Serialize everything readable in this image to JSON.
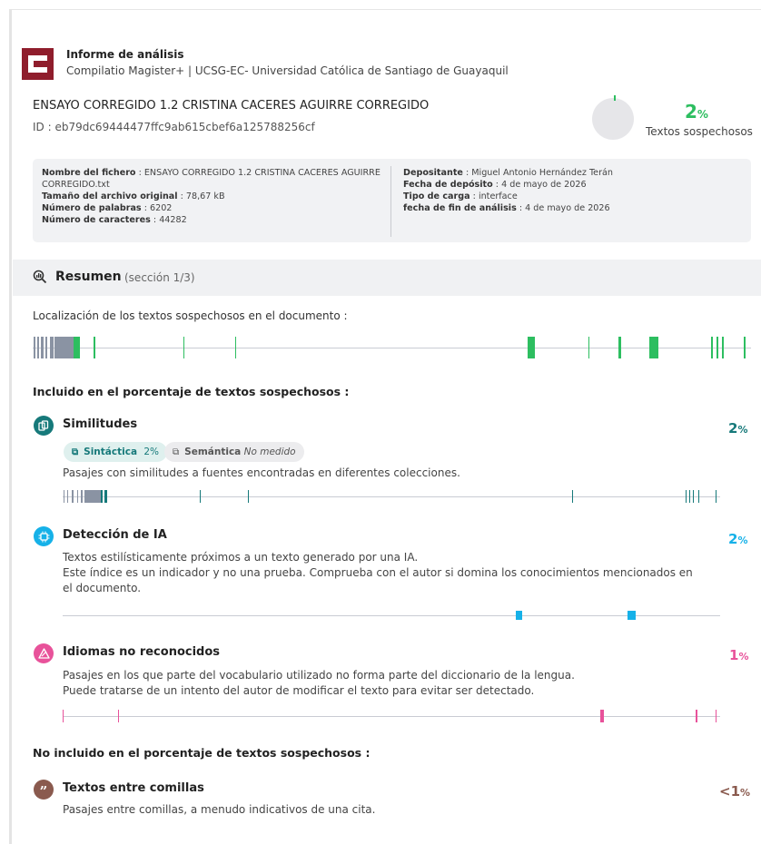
{
  "header": {
    "report_title": "Informe de análisis",
    "report_subtitle": "Compilatio Magister+ | UCSG-EC- Universidad Católica de Santiago de Guayaquil",
    "document_title": "ENSAYO CORREGIDO 1.2 CRISTINA CACERES AGUIRRE CORREGIDO",
    "document_id": "ID : eb79dc69444477ffc9ab615cbef6a125788256cf",
    "score_value": "2",
    "score_unit": "%",
    "score_label": "Textos sospechosos",
    "score_fraction": 0.02
  },
  "file_info": {
    "left": [
      {
        "label": "Nombre del fichero",
        "value": "ENSAYO CORREGIDO 1.2 CRISTINA CACERES AGUIRRE CORREGIDO.txt"
      },
      {
        "label": "Tamaño del archivo original",
        "value": "78,67 kB"
      },
      {
        "label": "Número de palabras",
        "value": "6202"
      },
      {
        "label": "Número de caracteres",
        "value": "44282"
      }
    ],
    "right": [
      {
        "label": "Depositante",
        "value": "Miguel Antonio Hernández Terán"
      },
      {
        "label": "Fecha de depósito",
        "value": "4 de mayo de 2026"
      },
      {
        "label": "Tipo de carga",
        "value": "interface"
      },
      {
        "label": "fecha de fin de análisis",
        "value": "4 de mayo de 2026"
      }
    ]
  },
  "summary": {
    "title": "Resumen",
    "section": "(sección 1/3)",
    "location_label": "Localización de los textos sospechosos en el documento :"
  },
  "included_heading": "Incluido en el porcentaje de textos sospechosos :",
  "not_included_heading": "No incluido en el porcentaje de textos sospechosos :",
  "categories": {
    "similitudes": {
      "title": "Similitudes",
      "pct_value": "2",
      "pct_unit": "%",
      "chip_sintactica_label": "Sintáctica",
      "chip_sintactica_value": "2%",
      "chip_semantica_label": "Semántica",
      "chip_semantica_value": "No medido",
      "description": "Pasajes con similitudes a fuentes encontradas en diferentes colecciones.",
      "color": "#16797a"
    },
    "ia": {
      "title": "Detección de IA",
      "pct_value": "2",
      "pct_unit": "%",
      "description_1": "Textos estilísticamente próximos a un texto generado por una IA.",
      "description_2": "Este índice es un indicador y no una prueba. Comprueba con el autor si domina los conocimientos mencionados en el documento.",
      "color": "#16b1e8"
    },
    "idiomas": {
      "title": "Idiomas no reconocidos",
      "pct_value": "1",
      "pct_unit": "%",
      "description_1": "Pasajes en los que parte del vocabulario utilizado no forma parte del diccionario de la lengua.",
      "description_2": "Puede tratarse de un intento del autor de modificar el texto para evitar ser detectado.",
      "color": "#e8529a"
    },
    "comillas": {
      "title": "Textos entre comillas",
      "pct_value": "<1",
      "pct_unit": "%",
      "description": "Pasajes entre comillas, a menudo indicativos de una cita.",
      "color": "#8a5a4e"
    }
  },
  "icons": {
    "summary": "magnifier-icon",
    "similitudes": "copy-icon",
    "ia": "chip-icon",
    "idiomas": "warning-icon",
    "comillas": "quote-icon"
  }
}
